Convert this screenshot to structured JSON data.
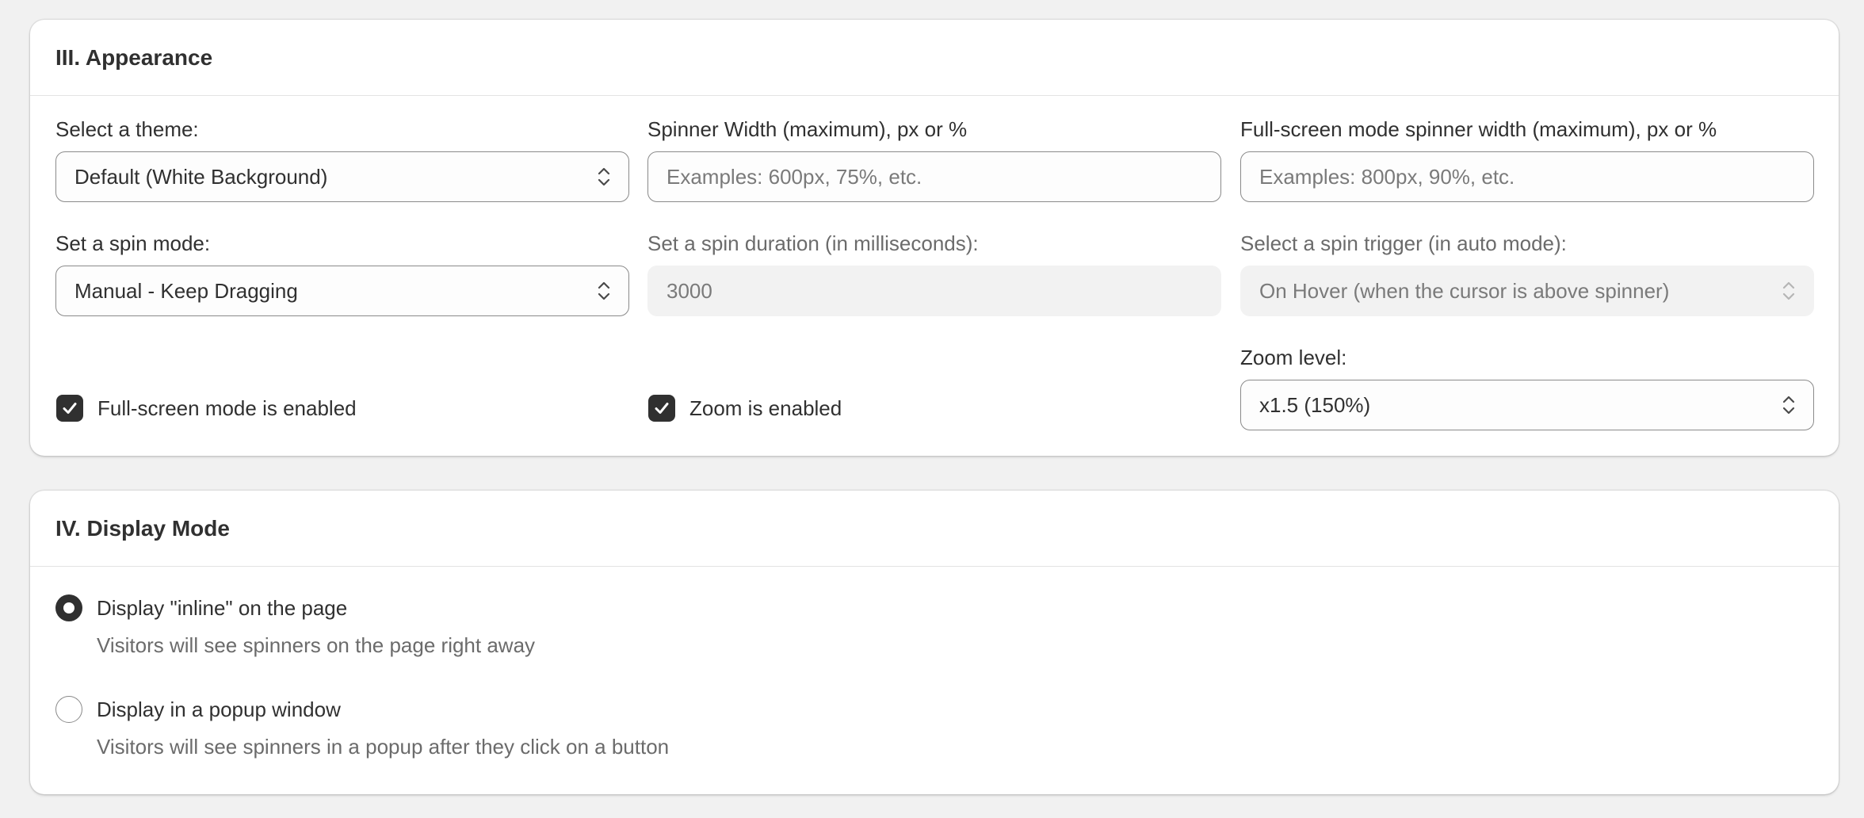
{
  "appearance": {
    "title": "III. Appearance",
    "theme": {
      "label": "Select a theme:",
      "value": "Default (White Background)"
    },
    "spinner_width": {
      "label": "Spinner Width (maximum), px or %",
      "placeholder": "Examples: 600px, 75%, etc."
    },
    "fullscreen_width": {
      "label": "Full-screen mode spinner width (maximum), px or %",
      "placeholder": "Examples: 800px, 90%, etc."
    },
    "spin_mode": {
      "label": "Set a spin mode:",
      "value": "Manual - Keep Dragging"
    },
    "spin_duration": {
      "label": "Set a spin duration (in milliseconds):",
      "value": "3000"
    },
    "spin_trigger": {
      "label": "Select a spin trigger (in auto mode):",
      "value": "On Hover (when the cursor is above spinner)"
    },
    "fullscreen_checkbox": {
      "label": "Full-screen mode is enabled",
      "checked": true
    },
    "zoom_checkbox": {
      "label": "Zoom is enabled",
      "checked": true
    },
    "zoom_level": {
      "label": "Zoom level:",
      "value": "x1.5 (150%)"
    }
  },
  "display_mode": {
    "title": "IV. Display Mode",
    "options": [
      {
        "label": "Display \"inline\" on the page",
        "help": "Visitors will see spinners on the page right away",
        "selected": true
      },
      {
        "label": "Display in a popup window",
        "help": "Visitors will see spinners in a popup after they click on a button",
        "selected": false
      }
    ]
  },
  "colors": {
    "background": "#f1f1f1",
    "card": "#ffffff",
    "text": "#303030",
    "muted_text": "#6b6b6b",
    "checkbox_fill": "#303030"
  }
}
